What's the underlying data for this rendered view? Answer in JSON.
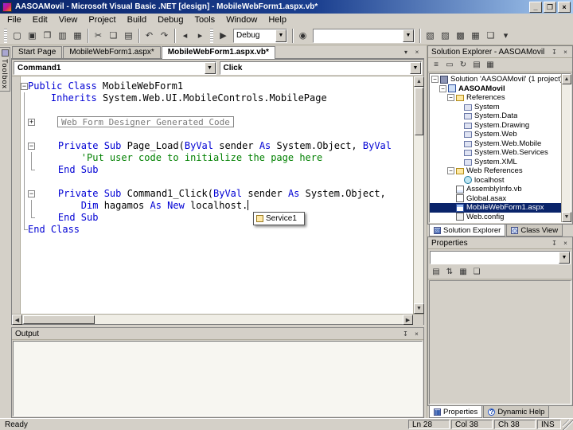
{
  "window": {
    "title": "AASOAMovil - Microsoft Visual Basic .NET [design] - MobileWebForm1.aspx.vb*",
    "minimize": "_",
    "maximize": "❐",
    "close": "×"
  },
  "menu": {
    "items": [
      "File",
      "Edit",
      "View",
      "Project",
      "Build",
      "Debug",
      "Tools",
      "Window",
      "Help"
    ]
  },
  "toolbar": {
    "items": [
      {
        "type": "grip"
      },
      {
        "type": "icon",
        "name": "new-project",
        "glyph": "▢"
      },
      {
        "type": "icon",
        "name": "add-item",
        "glyph": "▣"
      },
      {
        "type": "icon",
        "name": "open-file",
        "glyph": "❐"
      },
      {
        "type": "icon",
        "name": "save",
        "glyph": "▥"
      },
      {
        "type": "icon",
        "name": "save-all",
        "glyph": "▦"
      },
      {
        "type": "sep"
      },
      {
        "type": "icon",
        "name": "cut",
        "glyph": "✂"
      },
      {
        "type": "icon",
        "name": "copy",
        "glyph": "❏"
      },
      {
        "type": "icon",
        "name": "paste",
        "glyph": "▤"
      },
      {
        "type": "sep"
      },
      {
        "type": "icon",
        "name": "undo",
        "glyph": "↶"
      },
      {
        "type": "icon",
        "name": "redo",
        "glyph": "↷"
      },
      {
        "type": "sep"
      },
      {
        "type": "icon",
        "name": "navigate-back",
        "glyph": "◂"
      },
      {
        "type": "icon",
        "name": "navigate-forward",
        "glyph": "▸"
      },
      {
        "type": "grip"
      },
      {
        "type": "icon",
        "name": "start-debug",
        "glyph": "▶"
      },
      {
        "type": "combo",
        "name": "solution-configuration",
        "value": "Debug",
        "width": 68
      },
      {
        "type": "sep"
      },
      {
        "type": "icon",
        "name": "find",
        "glyph": "◉"
      },
      {
        "type": "combo",
        "name": "find",
        "value": "",
        "width": 128
      },
      {
        "type": "sep"
      },
      {
        "type": "icon",
        "name": "solution-explorer-window",
        "glyph": "▧"
      },
      {
        "type": "icon",
        "name": "properties-window",
        "glyph": "▨"
      },
      {
        "type": "icon",
        "name": "toolbox-window",
        "glyph": "▩"
      },
      {
        "type": "icon",
        "name": "class-view-window",
        "glyph": "▦"
      },
      {
        "type": "icon",
        "name": "object-browser",
        "glyph": "❏"
      },
      {
        "type": "icon",
        "name": "toolbar-options",
        "glyph": "▾"
      }
    ]
  },
  "toolbox": {
    "label": "Toolbox"
  },
  "document_tabs": {
    "tabs": [
      {
        "label": "Start Page",
        "active": false
      },
      {
        "label": "MobileWebForm1.aspx*",
        "active": false
      },
      {
        "label": "MobileWebForm1.aspx.vb*",
        "active": true
      }
    ],
    "controls": [
      {
        "name": "tab-scroll-down",
        "glyph": "▾"
      },
      {
        "name": "close-document",
        "glyph": "×"
      }
    ]
  },
  "editor": {
    "object_dropdown": "Command1",
    "event_dropdown": "Click",
    "dropdown_arrow": "▼",
    "lines": [
      {
        "outline": "m",
        "tokens": [
          [
            "k",
            "Public Class "
          ],
          [
            "i",
            "MobileWebForm1"
          ]
        ]
      },
      {
        "outline": "v",
        "tokens": [
          [
            "p",
            "    "
          ],
          [
            "k",
            "Inherits "
          ],
          [
            "i",
            "System.Web.UI.MobileControls.MobilePage"
          ]
        ]
      },
      {
        "outline": "v",
        "tokens": []
      },
      {
        "outline": "vp",
        "region": "Web Form Designer Generated Code"
      },
      {
        "outline": "v",
        "tokens": []
      },
      {
        "outline": "vm",
        "tokens": [
          [
            "p",
            "    "
          ],
          [
            "k",
            "Private Sub "
          ],
          [
            "i",
            "Page_Load"
          ],
          [
            "p",
            "("
          ],
          [
            "k",
            "ByVal "
          ],
          [
            "i",
            "sender "
          ],
          [
            "k",
            "As "
          ],
          [
            "i",
            "System.Object"
          ],
          [
            "p",
            ", "
          ],
          [
            "k",
            "ByVal"
          ]
        ]
      },
      {
        "outline": "vv",
        "tokens": [
          [
            "p",
            "        "
          ],
          [
            "c",
            "'Put user code to initialize the page here"
          ]
        ]
      },
      {
        "outline": "ve",
        "tokens": [
          [
            "p",
            "    "
          ],
          [
            "k",
            "End Sub"
          ]
        ]
      },
      {
        "outline": "v",
        "tokens": []
      },
      {
        "outline": "vm",
        "tokens": [
          [
            "p",
            "    "
          ],
          [
            "k",
            "Private Sub "
          ],
          [
            "i",
            "Command1_Click"
          ],
          [
            "p",
            "("
          ],
          [
            "k",
            "ByVal "
          ],
          [
            "i",
            "sender "
          ],
          [
            "k",
            "As "
          ],
          [
            "i",
            "System.Object"
          ],
          [
            "p",
            ","
          ]
        ]
      },
      {
        "outline": "vv",
        "tokens": [
          [
            "p",
            "        "
          ],
          [
            "k",
            "Dim "
          ],
          [
            "i",
            "hagamos "
          ],
          [
            "k",
            "As New "
          ],
          [
            "i",
            "localhost."
          ]
        ],
        "cursor": true
      },
      {
        "outline": "ve",
        "tokens": [
          [
            "p",
            "    "
          ],
          [
            "k",
            "End Sub"
          ]
        ]
      },
      {
        "outline": "e",
        "tokens": [
          [
            "k",
            "End Class"
          ]
        ]
      }
    ],
    "intellisense": {
      "items": [
        {
          "icon": "class-icon",
          "label": "Service1"
        }
      ]
    }
  },
  "output": {
    "title": "Output"
  },
  "solution_explorer": {
    "title": "Solution Explorer - AASOAMovil",
    "pin_glyph": "↧",
    "close_glyph": "×",
    "toolbar": [
      {
        "name": "view-code",
        "glyph": "≡"
      },
      {
        "name": "view-designer",
        "glyph": "▭"
      },
      {
        "name": "refresh",
        "glyph": "↻"
      },
      {
        "name": "show-all-files",
        "glyph": "▤"
      },
      {
        "name": "properties",
        "glyph": "▦"
      }
    ],
    "items": [
      {
        "label": "Solution 'AASOAMovil' (1 project)",
        "level": 0,
        "icon": "solution",
        "expand": "minus"
      },
      {
        "label": "AASOAMovil",
        "level": 1,
        "icon": "project",
        "expand": "minus",
        "bold": true
      },
      {
        "label": "References",
        "level": 2,
        "icon": "folder",
        "expand": "minus"
      },
      {
        "label": "System",
        "level": 3,
        "icon": "reference"
      },
      {
        "label": "System.Data",
        "level": 3,
        "icon": "reference"
      },
      {
        "label": "System.Drawing",
        "level": 3,
        "icon": "reference"
      },
      {
        "label": "System.Web",
        "level": 3,
        "icon": "reference"
      },
      {
        "label": "System.Web.Mobile",
        "level": 3,
        "icon": "reference"
      },
      {
        "label": "System.Web.Services",
        "level": 3,
        "icon": "reference"
      },
      {
        "label": "System.XML",
        "level": 3,
        "icon": "reference"
      },
      {
        "label": "Web References",
        "level": 2,
        "icon": "folder",
        "expand": "minus"
      },
      {
        "label": "localhost",
        "level": 3,
        "icon": "web"
      },
      {
        "label": "AssemblyInfo.vb",
        "level": 2,
        "icon": "vbfile"
      },
      {
        "label": "Global.asax",
        "level": 2,
        "icon": "file"
      },
      {
        "label": "MobileWebForm1.aspx",
        "level": 2,
        "icon": "form",
        "selected": true
      },
      {
        "label": "Web.config",
        "level": 2,
        "icon": "config"
      }
    ]
  },
  "panel_tabs": {
    "explorer": [
      {
        "label": "Solution Explorer",
        "icon": "solution-explorer-icon",
        "glyph": "▧",
        "active": true
      },
      {
        "label": "Class View",
        "icon": "class-view-icon",
        "glyph": "◇",
        "active": false
      }
    ],
    "properties": [
      {
        "label": "Properties",
        "icon": "properties-icon",
        "glyph": "▦",
        "active": true
      },
      {
        "label": "Dynamic Help",
        "icon": "dynamic-help-icon",
        "glyph": "?",
        "active": false,
        "q": true
      }
    ]
  },
  "properties_panel": {
    "title": "Properties",
    "object_value": "",
    "dropdown_arrow": "▼",
    "toolbar": [
      {
        "name": "categorized",
        "glyph": "▤"
      },
      {
        "name": "alphabetical",
        "glyph": "⇅"
      },
      {
        "name": "properties-view",
        "glyph": "▦"
      },
      {
        "name": "property-pages",
        "glyph": "❏"
      }
    ]
  },
  "status": {
    "ready": "Ready",
    "fields": [
      {
        "name": "line-indicator",
        "label": "Ln 28"
      },
      {
        "name": "column-indicator",
        "label": "Col 38"
      },
      {
        "name": "char-indicator",
        "label": "Ch 38"
      },
      {
        "name": "insert-mode-indicator",
        "label": "INS",
        "small": true
      }
    ]
  }
}
